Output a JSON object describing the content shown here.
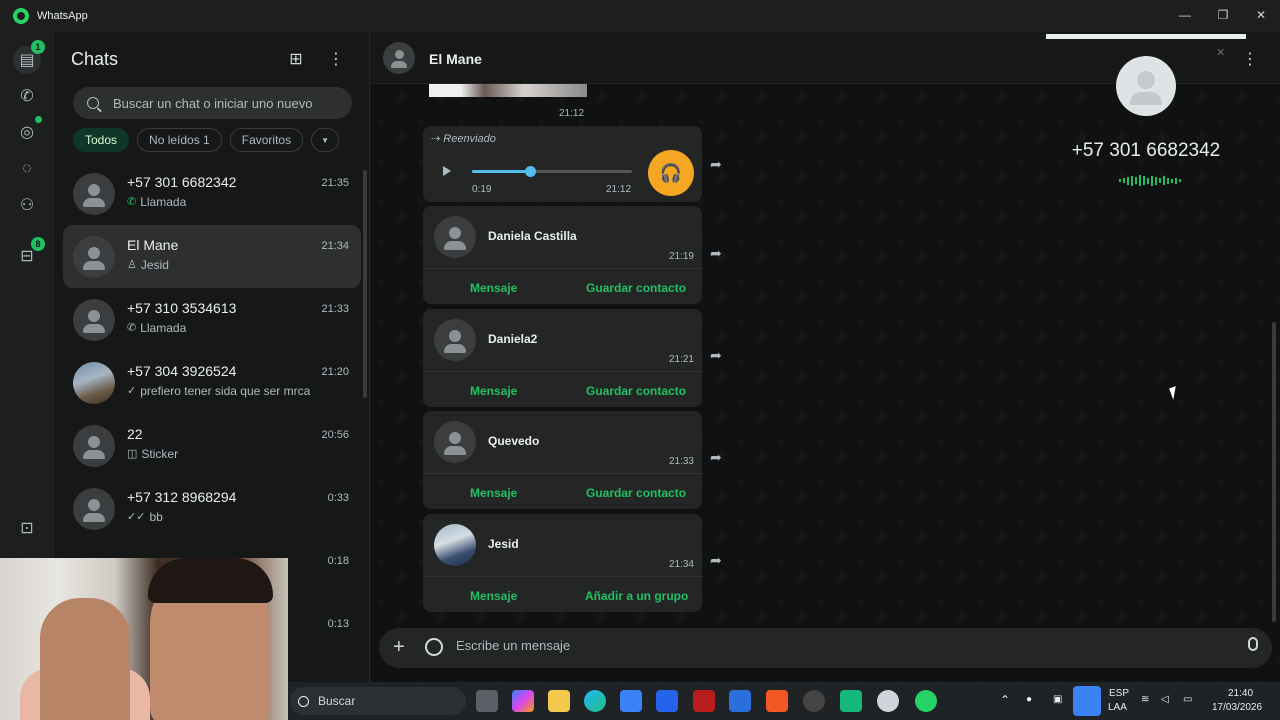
{
  "window": {
    "title": "WhatsApp",
    "controls": [
      "—",
      "❐",
      "✕"
    ]
  },
  "rail": {
    "chats_badge": "1",
    "updates_badge": "8"
  },
  "sidebar": {
    "title": "Chats",
    "search_placeholder": "Buscar un chat o iniciar uno nuevo",
    "filters": [
      {
        "label": "Todos",
        "active": true
      },
      {
        "label": "No leídos 1",
        "active": false
      },
      {
        "label": "Favoritos",
        "active": false
      }
    ],
    "chats": [
      {
        "name": "+57 301 6682342",
        "time": "21:35",
        "preview": "Llamada",
        "preview_icon": "phone-icon",
        "photo": false,
        "selected": false
      },
      {
        "name": "El Mane",
        "time": "21:34",
        "preview": "Jesid",
        "preview_icon": "contact-icon",
        "photo": false,
        "selected": true
      },
      {
        "name": "+57 310 3534613",
        "time": "21:33",
        "preview": "Llamada",
        "preview_icon": "phone-icon",
        "photo": false,
        "selected": false
      },
      {
        "name": "+57 304 3926524",
        "time": "21:20",
        "preview": "prefiero tener sida que ser mrca",
        "preview_icon": "check-icon",
        "photo": true,
        "selected": false
      },
      {
        "name": "22",
        "time": "20:56",
        "preview": "Sticker",
        "preview_icon": "sticker-icon",
        "photo": false,
        "selected": false
      },
      {
        "name": "+57 312 8968294",
        "time": "0:33",
        "preview": "bb",
        "preview_icon": "double-check-icon",
        "photo": false,
        "selected": false
      },
      {
        "name": "",
        "time": "0:18",
        "preview": "",
        "preview_icon": "",
        "photo": false,
        "selected": false
      },
      {
        "name": "",
        "time": "0:13",
        "preview": "",
        "preview_icon": "",
        "photo": false,
        "selected": false
      }
    ]
  },
  "conversation": {
    "name": "El Mane",
    "image_time": "21:12",
    "audio": {
      "forwarded_label": "Reenviado",
      "elapsed": "0:19",
      "time": "21:12",
      "progress": 0.36
    },
    "contacts": [
      {
        "name": "Daniela Castilla",
        "time": "21:19",
        "action1": "Mensaje",
        "action2": "Guardar contacto",
        "photo": false
      },
      {
        "name": "Daniela2",
        "time": "21:21",
        "action1": "Mensaje",
        "action2": "Guardar contacto",
        "photo": false
      },
      {
        "name": "Quevedo",
        "time": "21:33",
        "action1": "Mensaje",
        "action2": "Guardar contacto",
        "photo": false
      },
      {
        "name": "Jesid",
        "time": "21:34",
        "action1": "Mensaje",
        "action2": "Añadir a un grupo",
        "photo": true
      }
    ],
    "composer_placeholder": "Escribe un mensaje"
  },
  "call_overlay": {
    "number": "+57 301 6682342"
  },
  "taskbar": {
    "search_label": "Buscar",
    "language": "ESP",
    "layout": "LAA",
    "time": "21:40",
    "date": "17/03/2026"
  },
  "colors": {
    "accent": "#21c063",
    "audio_progress": "#53bdeb",
    "headset": "#f5a623"
  }
}
